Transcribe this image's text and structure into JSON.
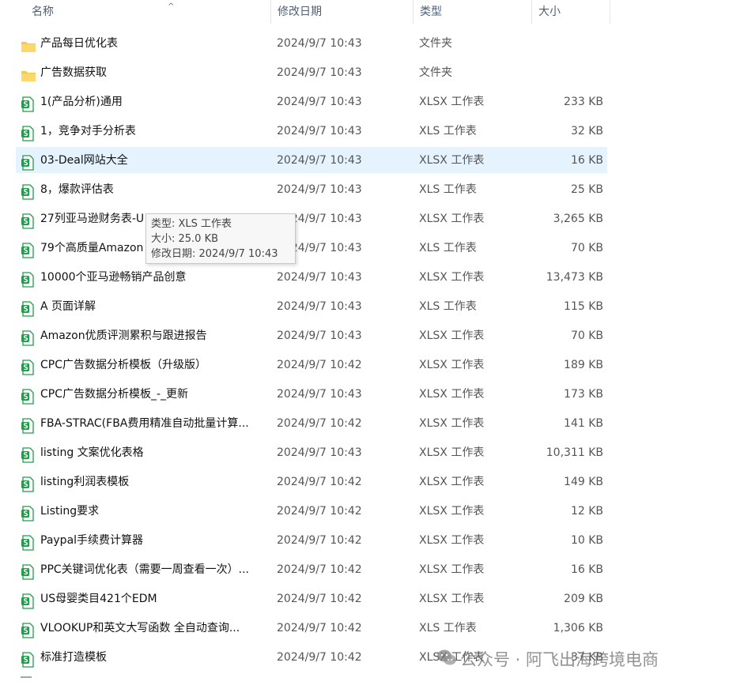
{
  "header": {
    "name": "名称",
    "modified": "修改日期",
    "type": "类型",
    "size": "大小",
    "sort_indicator": "^"
  },
  "icons": {
    "folder": "folder-icon",
    "xlsx": "spreadsheet-file-icon",
    "colors": {
      "folder": "#f8c64a",
      "sheet": "#1e9e4a"
    }
  },
  "files": [
    {
      "name": "产品每日优化表",
      "date": "2024/9/7 10:43",
      "type": "文件夹",
      "size": "",
      "kind": "folder"
    },
    {
      "name": "广告数据获取",
      "date": "2024/9/7 10:43",
      "type": "文件夹",
      "size": "",
      "kind": "folder"
    },
    {
      "name": "1(产品分析)通用",
      "date": "2024/9/7 10:43",
      "type": "XLSX 工作表",
      "size": "233 KB",
      "kind": "sheet"
    },
    {
      "name": "1，竞争对手分析表",
      "date": "2024/9/7 10:43",
      "type": "XLS 工作表",
      "size": "32 KB",
      "kind": "sheet"
    },
    {
      "name": "03-Deal网站大全",
      "date": "2024/9/7 10:43",
      "type": "XLSX 工作表",
      "size": "16 KB",
      "kind": "sheet",
      "selected": true
    },
    {
      "name": "8，爆款评估表",
      "date": "2024/9/7 10:43",
      "type": "XLS 工作表",
      "size": "25 KB",
      "kind": "sheet"
    },
    {
      "name": "27列亚马逊财务表-U",
      "date": "2024/9/7 10:43",
      "type": "XLSX 工作表",
      "size": "3,265 KB",
      "kind": "sheet"
    },
    {
      "name": "79个高质量Amazon",
      "date": "2024/9/7 10:43",
      "type": "XLS 工作表",
      "size": "70 KB",
      "kind": "sheet"
    },
    {
      "name": "10000个亚马逊畅销产品创意",
      "date": "2024/9/7 10:43",
      "type": "XLSX 工作表",
      "size": "13,473 KB",
      "kind": "sheet"
    },
    {
      "name": "A 页面详解",
      "date": "2024/9/7 10:43",
      "type": "XLS 工作表",
      "size": "115 KB",
      "kind": "sheet"
    },
    {
      "name": "Amazon优质评测累积与跟进报告",
      "date": "2024/9/7 10:43",
      "type": "XLSX 工作表",
      "size": "70 KB",
      "kind": "sheet"
    },
    {
      "name": "CPC广告数据分析模板（升级版）",
      "date": "2024/9/7 10:42",
      "type": "XLSX 工作表",
      "size": "189 KB",
      "kind": "sheet"
    },
    {
      "name": "CPC广告数据分析模板_-_更新",
      "date": "2024/9/7 10:43",
      "type": "XLSX 工作表",
      "size": "173 KB",
      "kind": "sheet"
    },
    {
      "name": "FBA-STRAC(FBA费用精准自动批量计算...",
      "date": "2024/9/7 10:42",
      "type": "XLSX 工作表",
      "size": "141 KB",
      "kind": "sheet"
    },
    {
      "name": "listing 文案优化表格",
      "date": "2024/9/7 10:43",
      "type": "XLSX 工作表",
      "size": "10,311 KB",
      "kind": "sheet"
    },
    {
      "name": "listing利润表模板",
      "date": "2024/9/7 10:42",
      "type": "XLSX 工作表",
      "size": "149 KB",
      "kind": "sheet"
    },
    {
      "name": "Listing要求",
      "date": "2024/9/7 10:42",
      "type": "XLSX 工作表",
      "size": "12 KB",
      "kind": "sheet"
    },
    {
      "name": "Paypal手续费计算器",
      "date": "2024/9/7 10:42",
      "type": "XLSX 工作表",
      "size": "10 KB",
      "kind": "sheet"
    },
    {
      "name": "PPC关键词优化表（需要一周查看一次）...",
      "date": "2024/9/7 10:42",
      "type": "XLSX 工作表",
      "size": "16 KB",
      "kind": "sheet"
    },
    {
      "name": "US母婴类目421个EDM",
      "date": "2024/9/7 10:42",
      "type": "XLSX 工作表",
      "size": "209 KB",
      "kind": "sheet"
    },
    {
      "name": "VLOOKUP和英文大写函数 全自动查询...",
      "date": "2024/9/7 10:42",
      "type": "XLS 工作表",
      "size": "1,306 KB",
      "kind": "sheet"
    },
    {
      "name": "标准打造模板",
      "date": "2024/9/7 10:42",
      "type": "XLSX 工作表",
      "size": "37 KB",
      "kind": "sheet"
    }
  ],
  "tooltip": {
    "type_line": "类型: XLS 工作表",
    "size_line": "大小: 25.0 KB",
    "date_line": "修改日期: 2024/9/7 10:43"
  },
  "watermark": {
    "text": "公众号 · 阿飞出海跨境电商"
  }
}
